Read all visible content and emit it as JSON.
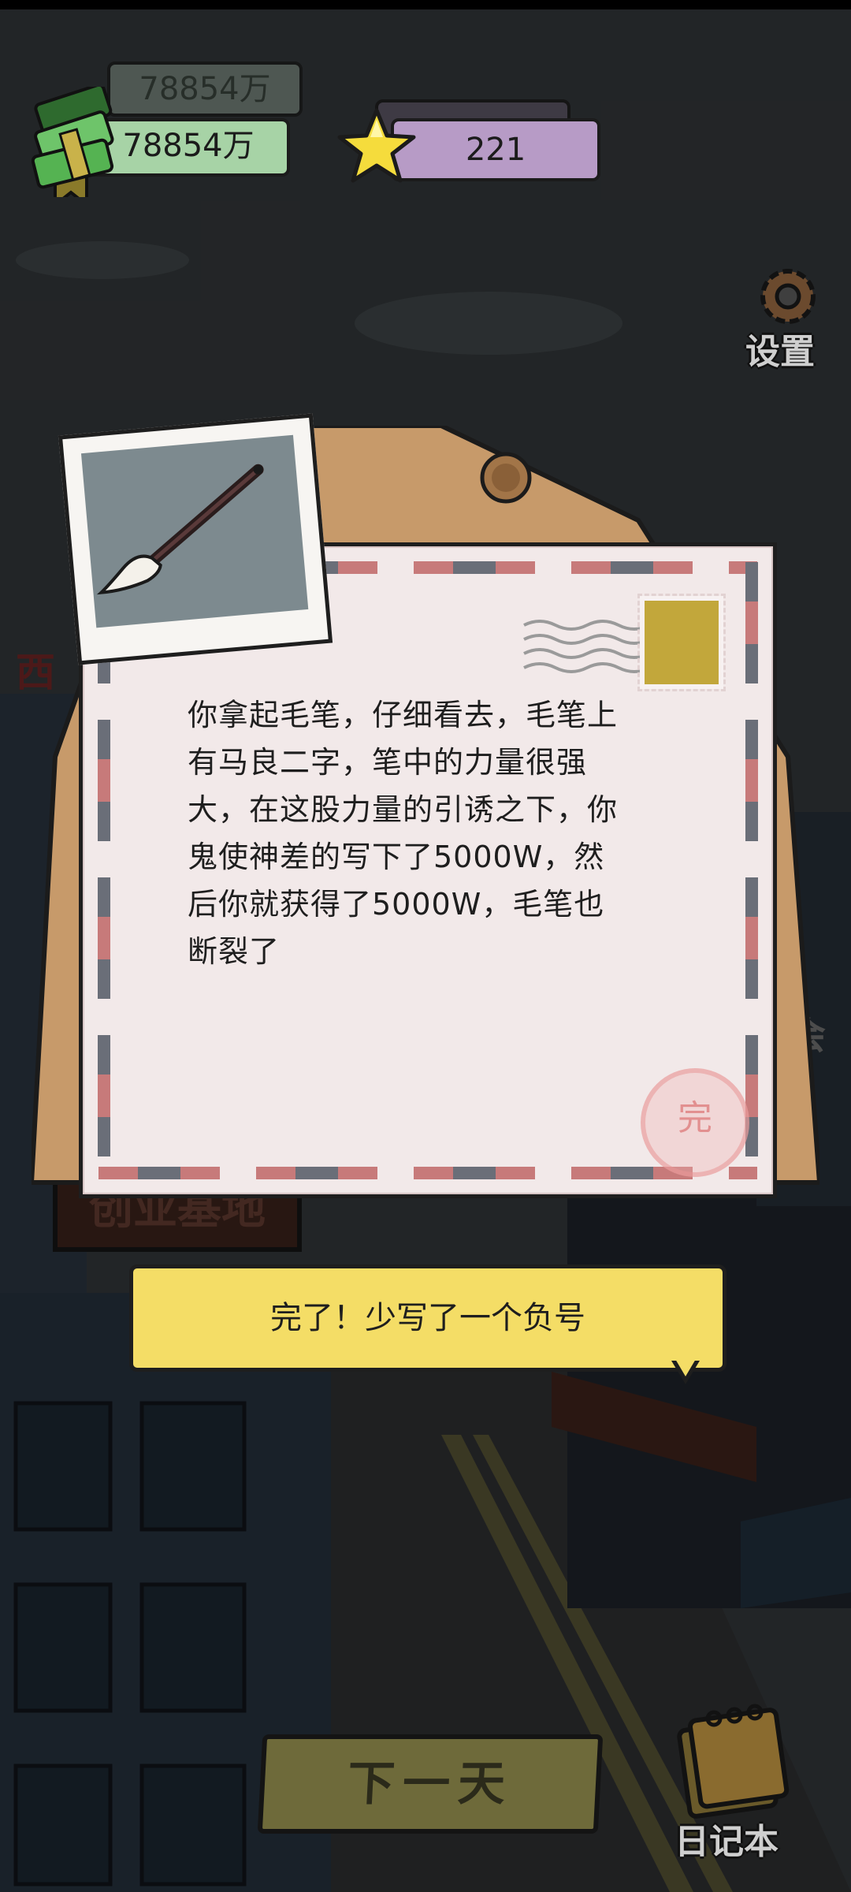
{
  "hud": {
    "money_back": "78854万",
    "money": "78854万",
    "star_count": "221",
    "money_icon": "cash-stack-icon",
    "star_icon": "star-icon"
  },
  "settings": {
    "label": "设置",
    "icon": "gear-icon"
  },
  "letter": {
    "lines": [
      "你拿起毛笔，仔细看去，毛笔上",
      "有马良二字，笔中的力量很强",
      "大，在这股力量的引诱之下，你",
      "鬼使神差的写下了5000W，然",
      "后你就获得了5000W，毛笔也",
      "断裂了"
    ],
    "seal": "完",
    "photo_icon": "brush-icon"
  },
  "response": {
    "text": "完了！少写了一个负号"
  },
  "next_day": {
    "label": "下一天"
  },
  "diary": {
    "label": "日记本",
    "icon": "calendar-icon"
  },
  "background_signs": {
    "left": "西",
    "startup": "创业基地",
    "right": "会"
  },
  "colors": {
    "bubble": "#f4dd66",
    "paper": "#f2e9e9",
    "border_red": "#c77a7a",
    "border_gray": "#6a6e78",
    "star_pill": "#b79bc6",
    "money_pill": "#a7d3a6"
  }
}
